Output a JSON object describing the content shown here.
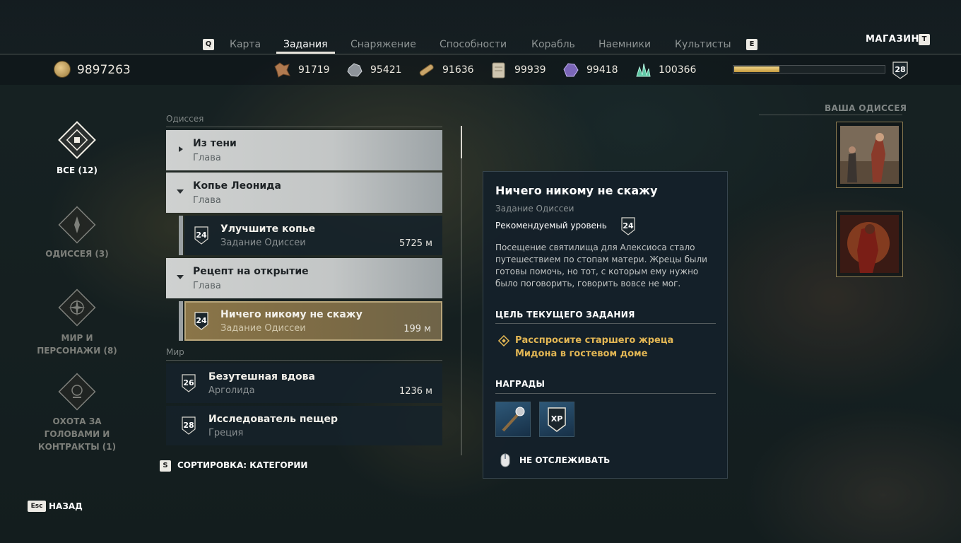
{
  "nav": {
    "left_key": "Q",
    "right_key": "E",
    "tabs": [
      {
        "label": "Карта",
        "active": false
      },
      {
        "label": "Задания",
        "active": true
      },
      {
        "label": "Снаряжение",
        "active": false
      },
      {
        "label": "Способности",
        "active": false
      },
      {
        "label": "Корабль",
        "active": false
      },
      {
        "label": "Наемники",
        "active": false
      },
      {
        "label": "Культисты",
        "active": false
      }
    ],
    "shop_label": "МАГАЗИН",
    "shop_key": "T"
  },
  "resources": {
    "drachmae": "9897263",
    "items": [
      {
        "icon": "leather-icon",
        "value": "91719"
      },
      {
        "icon": "iron-ore-icon",
        "value": "95421"
      },
      {
        "icon": "wood-icon",
        "value": "91636"
      },
      {
        "icon": "ancient-tablet-icon",
        "value": "99939"
      },
      {
        "icon": "obsidian-icon",
        "value": "99418"
      },
      {
        "icon": "crystal-icon",
        "value": "100366"
      }
    ],
    "xp_progress": 0.3,
    "player_level": "28"
  },
  "categories": [
    {
      "label": "ВСЕ (12)",
      "active": true,
      "icon": "all-quests-icon"
    },
    {
      "label": "ОДИССЕЯ (3)",
      "active": false,
      "icon": "odyssey-icon"
    },
    {
      "label": "МИР И ПЕРСОНАЖИ (8)",
      "active": false,
      "icon": "world-characters-icon"
    },
    {
      "label": "ОХОТА ЗА ГОЛОВАМИ И КОНТРАКТЫ (1)",
      "active": false,
      "icon": "bounty-contracts-icon"
    }
  ],
  "quest_list": {
    "section_odyssey": "Одиссея",
    "section_world": "Мир",
    "chapters": [
      {
        "title": "Из тени",
        "sub": "Глава"
      },
      {
        "title": "Копье Леонида",
        "sub": "Глава"
      },
      {
        "title": "Рецепт на открытие",
        "sub": "Глава"
      }
    ],
    "quests": [
      {
        "level": "24",
        "title": "Улучшите копье",
        "sub": "Задание Одиссеи",
        "distance": "5725 м"
      },
      {
        "level": "24",
        "title": "Ничего никому не скажу",
        "sub": "Задание Одиссеи",
        "distance": "199 м"
      },
      {
        "level": "26",
        "title": "Безутешная вдова",
        "sub": "Арголида",
        "distance": "1236 м"
      },
      {
        "level": "28",
        "title": "Исследователь пещер",
        "sub": "Греция",
        "distance": ""
      }
    ],
    "sort_key": "S",
    "sort_label": "СОРТИРОВКА: КАТЕГОРИИ"
  },
  "detail": {
    "title": "Ничего никому не скажу",
    "type": "Задание Одиссеи",
    "recommended_label": "Рекомендуемый уровень",
    "recommended_level": "24",
    "description": "Посещение святилища для Алексиоса стало путешествием по стопам матери. Жрецы были готовы помочь, но тот, с которым ему нужно было поговорить, говорить вовсе не мог.",
    "objective_header": "ЦЕЛЬ ТЕКУЩЕГО ЗАДАНИЯ",
    "objective": "Расспросите старшего жреца Мидона в гостевом доме",
    "rewards_header": "НАГРАДЫ",
    "rewards": [
      {
        "icon": "mace-weapon-icon",
        "label": ""
      },
      {
        "icon": "xp-icon",
        "label": "XP"
      }
    ],
    "untrack_label": "НЕ ОТСЛЕЖИВАТЬ"
  },
  "odyssey": {
    "header": "ВАША ОДИССЕЯ"
  },
  "back": {
    "key": "Esc",
    "label": "НАЗАД"
  },
  "colors": {
    "objective_gold": "#e2b654",
    "selected_quest_gold": "#8a7548",
    "panel_bg": "#14202a"
  }
}
